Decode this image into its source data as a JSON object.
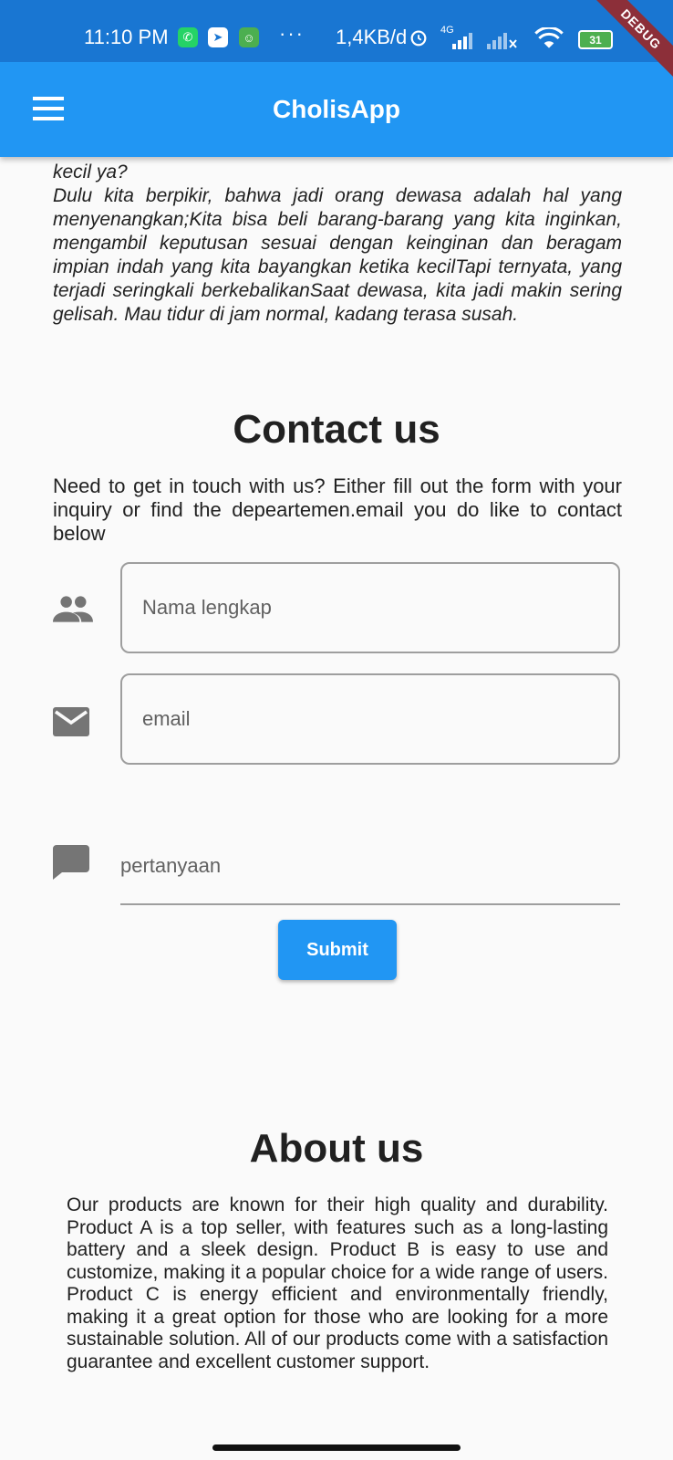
{
  "status_bar": {
    "time": "11:10 PM",
    "dots": "···",
    "network_speed": "1,4KB/d",
    "network_type": "4G",
    "battery": "31",
    "debug_label": "DEBUG"
  },
  "app_bar": {
    "title": "CholisApp"
  },
  "intro": {
    "text": "kecil ya?\nDulu kita berpikir, bahwa jadi orang dewasa adalah hal yang menyenangkan;Kita bisa beli barang-barang yang kita inginkan, mengambil keputusan sesuai dengan keinginan dan beragam impian indah yang kita bayangkan ketika kecilTapi ternyata, yang terjadi seringkali berkebalikanSaat dewasa, kita jadi makin sering gelisah. Mau tidur di jam normal, kadang terasa susah."
  },
  "contact": {
    "title": "Contact us",
    "description": "Need to get in touch with us? Either fill out the form with your inquiry or find the depeartemen.email you do like to contact below",
    "fields": {
      "name_placeholder": "Nama lengkap",
      "email_placeholder": "email",
      "question_placeholder": "pertanyaan"
    },
    "submit_label": "Submit"
  },
  "about": {
    "title": "About us",
    "text": "Our products are known for their high quality and durability. Product A is a top seller, with features such as a long-lasting battery and a sleek design. Product B is easy to use and customize, making it a popular choice for a wide range of users. Product C is energy efficient and environmentally friendly, making it a great option for those who are looking for a more sustainable solution. All of our products come with a satisfaction guarantee and excellent customer support."
  },
  "colors": {
    "app_bar": "#2196f3",
    "status_bar": "#1976d2",
    "accent": "#2196f3",
    "icon_gray": "#757575"
  }
}
